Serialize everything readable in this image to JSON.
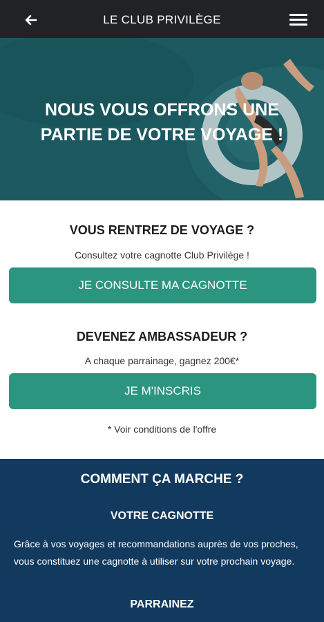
{
  "topbar": {
    "title": "LE CLUB PRIVILÈGE",
    "back_icon": "arrow-left-icon",
    "menu_icon": "hamburger-menu-icon"
  },
  "hero": {
    "title_line1": "NOUS VOUS OFFRONS UNE",
    "title_line2": "PARTIE DE VOTRE VOYAGE !"
  },
  "cagnotte": {
    "heading": "VOUS RENTREZ DE VOYAGE ?",
    "text": "Consultez votre cagnotte Club Privilège !",
    "button": "JE CONSULTE MA CAGNOTTE"
  },
  "ambassadeur": {
    "heading": "DEVENEZ AMBASSADEUR ?",
    "text": "A chaque parrainage, gagnez 200€*",
    "button": "JE M'INSCRIS",
    "conditions": "* Voir conditions de l'offre"
  },
  "how": {
    "title": "COMMENT ÇA MARCHE ?",
    "section1_title": "VOTRE CAGNOTTE",
    "section1_text": "Grâce à vos voyages et recommandations auprès de vos proches, vous constituez une cagnotte à utiliser sur votre prochain voyage.",
    "section2_title": "PARRAINEZ"
  },
  "colors": {
    "topbar": "#1f2326",
    "accent_button": "#2c9580",
    "how_background": "#12395e",
    "hero_teal": "#1f5e66"
  }
}
